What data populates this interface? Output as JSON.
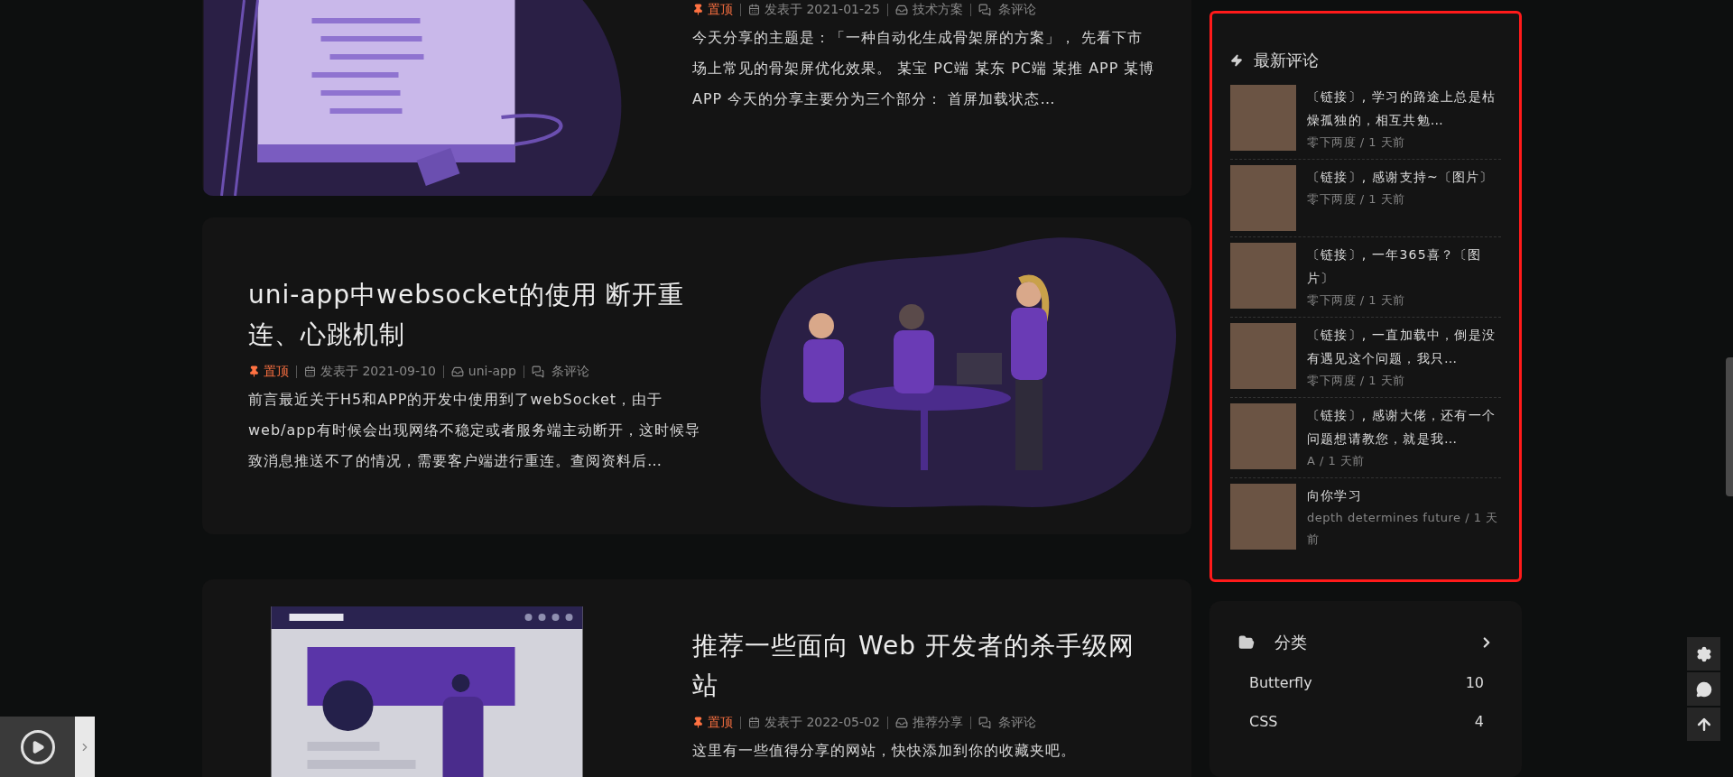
{
  "articles": [
    {
      "kind": "image-left",
      "meta": {
        "pinned": "置顶",
        "date": "发表于 2021-01-25",
        "category": "技术方案",
        "comments": "条评论"
      },
      "excerpt": "今天分享的主题是：「一种自动化生成骨架屏的方案」， 先看下市场上常见的骨架屏优化效果。 某宝 PC端 某东 PC端 某推 APP 某博 APP 今天的分享主要分为三个部分： 首屏加载状态…"
    },
    {
      "kind": "image-right",
      "title": "uni-app中websocket的使用 断开重连、心跳机制",
      "meta": {
        "pinned": "置顶",
        "date": "发表于 2021-09-10",
        "category": "uni-app",
        "comments": "条评论"
      },
      "excerpt": "前言最近关于H5和APP的开发中使用到了webSocket，由于web/app有时候会出现网络不稳定或者服务端主动断开，这时候导致消息推送不了的情况，需要客户端进行重连。查阅资料后…"
    },
    {
      "kind": "image-left",
      "title": "推荐一些面向 Web 开发者的杀手级网站",
      "meta": {
        "pinned": "置顶",
        "date": "发表于 2022-05-02",
        "category": "推荐分享",
        "comments": "条评论"
      },
      "excerpt": "这里有一些值得分享的网站，快快添加到你的收藏夹吧。"
    }
  ],
  "recent_comments": {
    "title": "最新评论",
    "items": [
      {
        "text": "〔链接〕, 学习的路途上总是枯燥孤独的，相互共勉…",
        "meta": "零下两度 / 1 天前"
      },
      {
        "text": "〔链接〕, 感谢支持~〔图片〕",
        "meta": "零下两度 / 1 天前"
      },
      {
        "text": "〔链接〕, 一年365喜？〔图片〕",
        "meta": "零下两度 / 1 天前"
      },
      {
        "text": "〔链接〕, 一直加载中，倒是没有遇见这个问题，我只…",
        "meta": "零下两度 / 1 天前"
      },
      {
        "text": "〔链接〕, 感谢大佬，还有一个问题想请教您，就是我…",
        "meta": "A / 1 天前"
      },
      {
        "text": "向你学习",
        "meta": "depth determines future / 1 天前"
      }
    ]
  },
  "categories": {
    "title": "分类",
    "items": [
      {
        "name": "Butterfly",
        "count": "10"
      },
      {
        "name": "CSS",
        "count": "4"
      }
    ]
  }
}
